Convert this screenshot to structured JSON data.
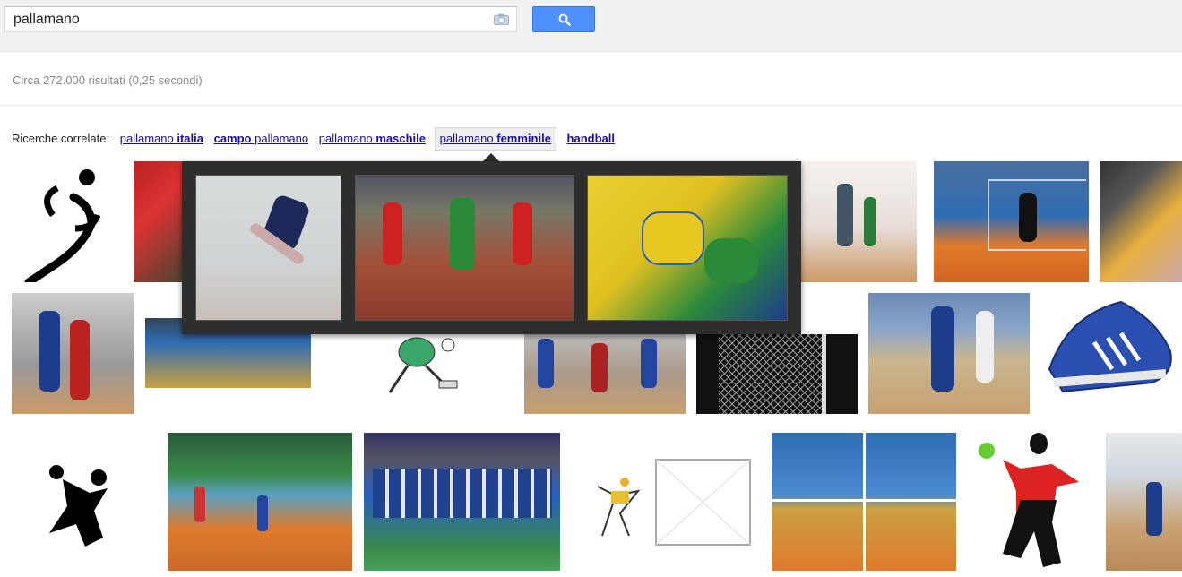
{
  "search": {
    "query": "pallamano",
    "camera_icon": "camera-icon",
    "search_icon": "magnifier-icon"
  },
  "stats": "Circa 272.000 risultati (0,25 secondi)",
  "related": {
    "label": "Ricerche correlate:",
    "items": [
      {
        "pre": "pallamano ",
        "bold": "italia",
        "post": ""
      },
      {
        "pre": "",
        "bold": "campo",
        "post": " pallamano"
      },
      {
        "pre": "pallamano ",
        "bold": "maschile",
        "post": ""
      },
      {
        "pre": "pallamano ",
        "bold": "femminile",
        "post": ""
      },
      {
        "pre": "",
        "bold": "handball",
        "post": ""
      }
    ]
  },
  "colors": {
    "accent": "#4d90fe",
    "link": "#1a0dab",
    "court_orange": "#e07a2c",
    "court_blue": "#2f6db5"
  }
}
